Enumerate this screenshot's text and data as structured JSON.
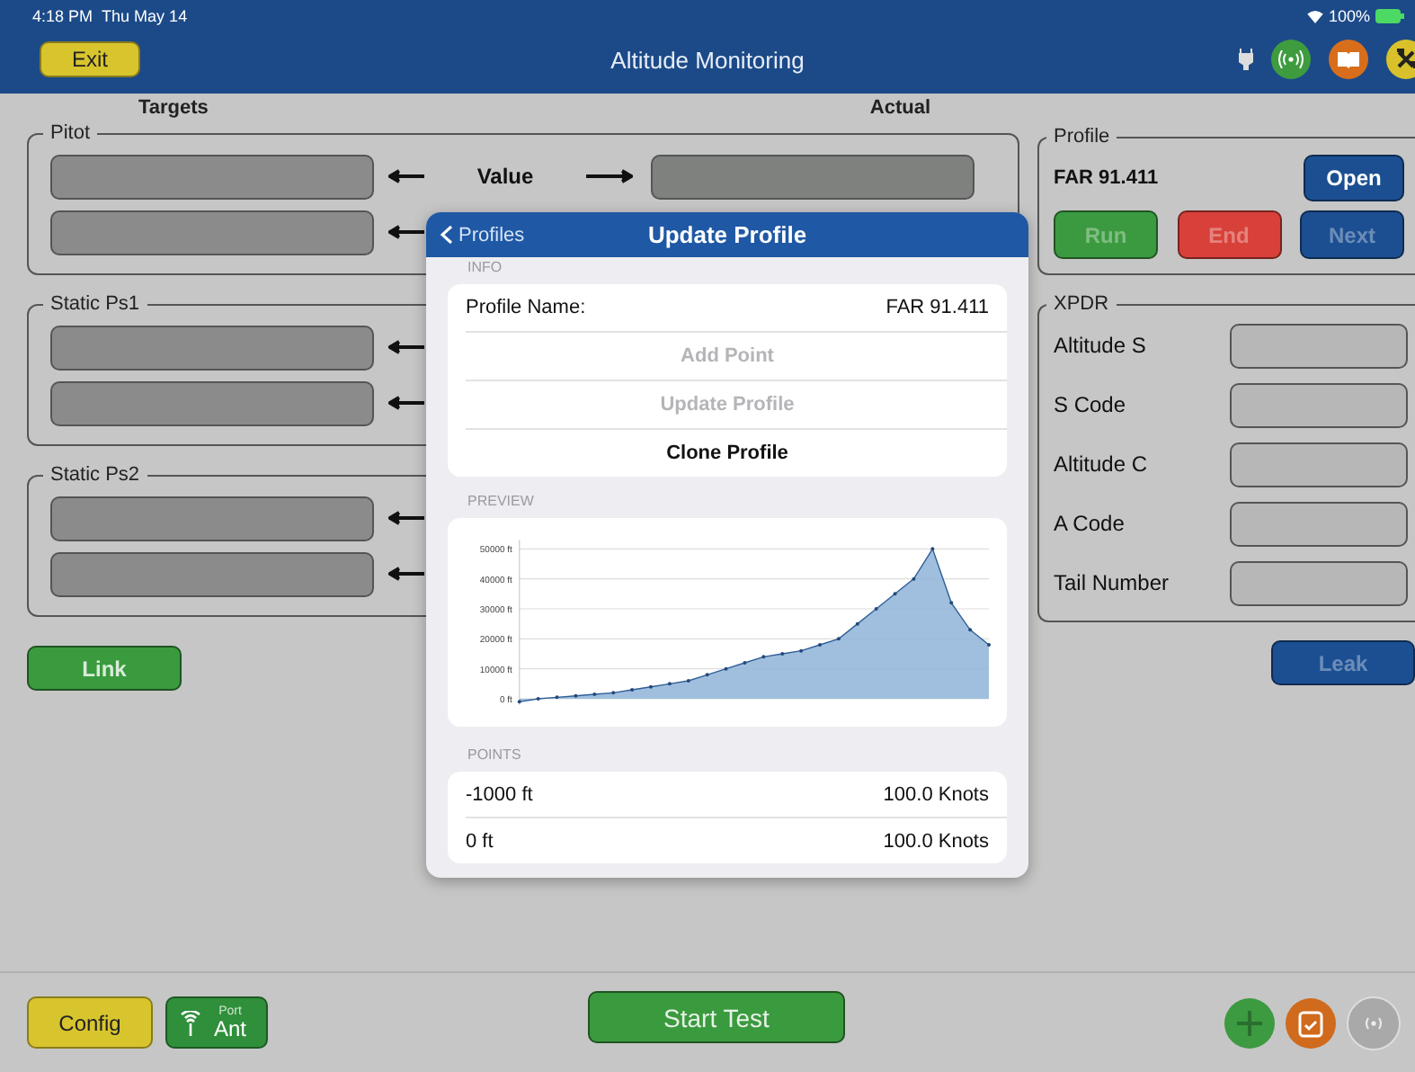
{
  "status_bar": {
    "time": "4:18 PM",
    "date": "Thu May 14",
    "battery": "100%"
  },
  "header": {
    "exit": "Exit",
    "title": "Altitude Monitoring"
  },
  "columns": {
    "targets": "Targets",
    "actual": "Actual"
  },
  "groups": [
    {
      "title": "Pitot",
      "rows": [
        {
          "kind": "value",
          "label": "Value"
        },
        {
          "kind": "plain"
        }
      ]
    },
    {
      "title": "Static Ps1",
      "rows": [
        {
          "kind": "plain"
        },
        {
          "kind": "plain"
        }
      ]
    },
    {
      "title": "Static Ps2",
      "rows": [
        {
          "kind": "plain"
        },
        {
          "kind": "plain"
        }
      ]
    }
  ],
  "link": "Link",
  "profile": {
    "title": "Profile",
    "name": "FAR 91.411",
    "open": "Open",
    "actions": [
      {
        "label": "Run",
        "color": "#3b9a40",
        "disabled": true
      },
      {
        "label": "End",
        "color": "#d8413a",
        "disabled": true
      },
      {
        "label": "Next",
        "color": "#1c4f92",
        "disabled": true
      }
    ]
  },
  "xpdr": {
    "title": "XPDR",
    "fields": [
      "Altitude S",
      "S Code",
      "Altitude C",
      "A Code",
      "Tail Number"
    ]
  },
  "leak": "Leak",
  "footer": {
    "config": "Config",
    "port_label": "Port",
    "port_value": "Ant",
    "start": "Start Test"
  },
  "modal": {
    "back": "Profiles",
    "title": "Update Profile",
    "info_header": "INFO",
    "profile_label": "Profile Name:",
    "profile_value": "FAR 91.411",
    "actions": [
      {
        "label": "Add Point",
        "disabled": true
      },
      {
        "label": "Update Profile",
        "disabled": true
      },
      {
        "label": "Clone Profile",
        "disabled": false
      }
    ],
    "preview_header": "PREVIEW",
    "chart_data": {
      "type": "area",
      "grid": true,
      "ylim": [
        -2000,
        53000
      ],
      "yticks": [
        {
          "value": 0,
          "label": "0 ft"
        },
        {
          "value": 10000,
          "label": "10000 ft"
        },
        {
          "value": 20000,
          "label": "20000 ft"
        },
        {
          "value": 30000,
          "label": "30000 ft"
        },
        {
          "value": 40000,
          "label": "40000 ft"
        },
        {
          "value": 50000,
          "label": "50000 ft"
        }
      ],
      "series": [
        {
          "color": "#8fb4d8",
          "values": [
            -1000,
            0,
            500,
            1000,
            1500,
            2000,
            3000,
            4000,
            5000,
            6000,
            8000,
            10000,
            12000,
            14000,
            15000,
            16000,
            18000,
            20000,
            25000,
            30000,
            35000,
            40000,
            50000,
            32000,
            23000,
            18000
          ]
        }
      ]
    },
    "points_header": "POINTS",
    "points": [
      {
        "altitude": "-1000 ft",
        "speed": "100.0 Knots"
      },
      {
        "altitude": "0 ft",
        "speed": "100.0 Knots"
      }
    ]
  }
}
